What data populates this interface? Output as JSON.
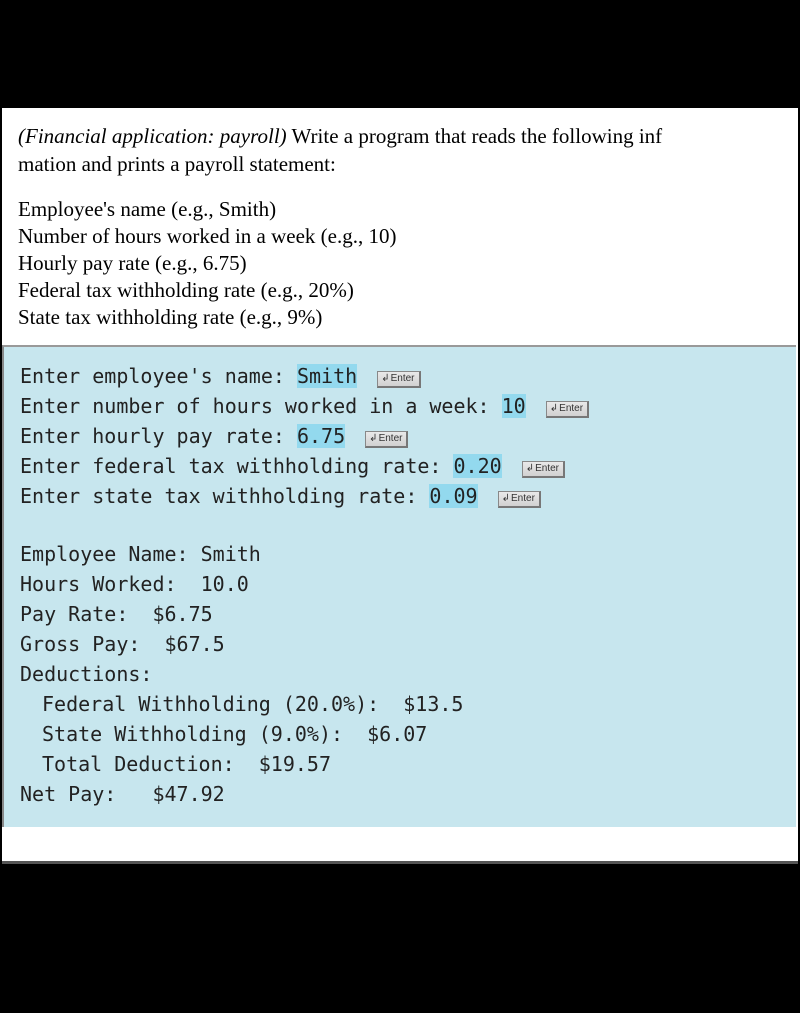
{
  "problem": {
    "title_italic": "(Financial application: payroll)",
    "body": " Write a program that reads the following infmation and prints a payroll statement:",
    "body_line1": " Write a program that reads the following inf",
    "body_line2": "mation and prints a payroll statement:"
  },
  "inputs": {
    "l1": "Employee's name (e.g., Smith)",
    "l2": "Number of hours worked in a week (e.g., 10)",
    "l3": "Hourly pay rate (e.g., 6.75)",
    "l4": "Federal tax withholding rate (e.g., 20%)",
    "l5": "State tax withholding rate (e.g., 9%)"
  },
  "console": {
    "enter_label": "Enter",
    "p1": {
      "prompt": "Enter employee's name: ",
      "value": "Smith"
    },
    "p2": {
      "prompt": "Enter number of hours worked in a week: ",
      "value": "10"
    },
    "p3": {
      "prompt": "Enter hourly pay rate: ",
      "value": "6.75"
    },
    "p4": {
      "prompt": "Enter federal tax withholding rate: ",
      "value": "0.20"
    },
    "p5": {
      "prompt": "Enter state tax withholding rate: ",
      "value": "0.09"
    },
    "out": {
      "name": "Employee Name: Smith",
      "hours": "Hours Worked:  10.0",
      "rate": "Pay Rate:  $6.75",
      "gross": "Gross Pay:  $67.5",
      "ded_header": "Deductions:",
      "fed": "Federal Withholding (20.0%):  $13.5",
      "state": "State Withholding (9.0%):  $6.07",
      "total": "Total Deduction:  $19.57",
      "net": "Net Pay:   $47.92"
    }
  }
}
